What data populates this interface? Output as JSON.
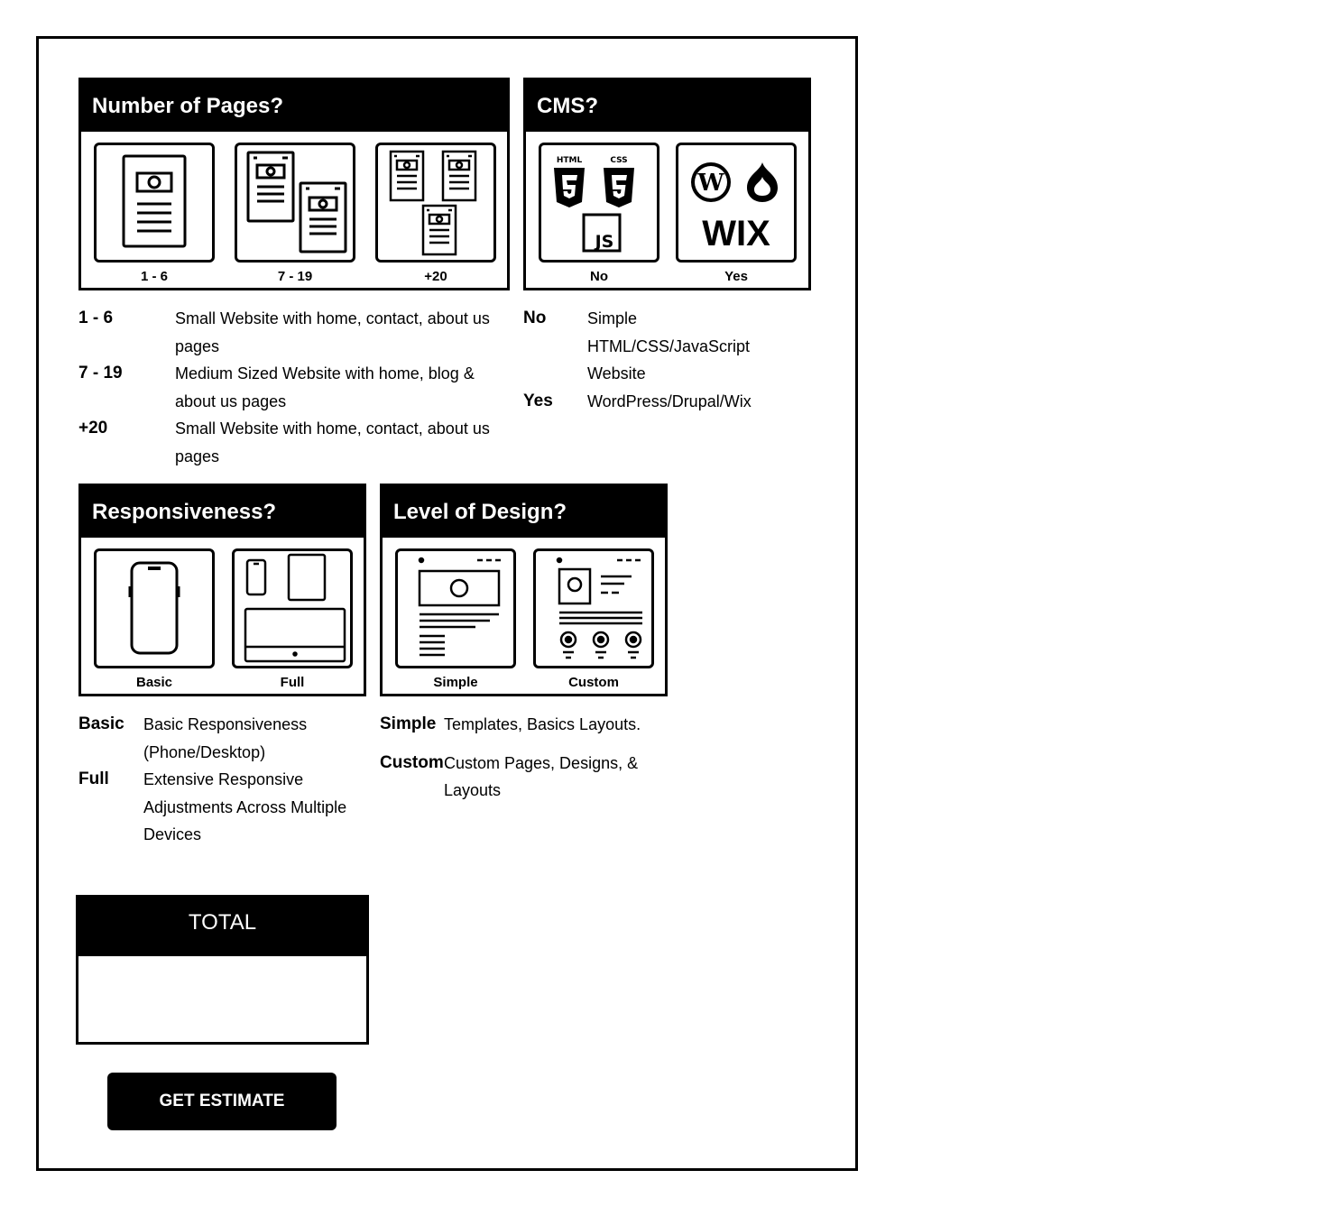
{
  "pages": {
    "title": "Number of Pages?",
    "options": [
      {
        "label": "1 - 6",
        "icon": "single-page-icon"
      },
      {
        "label": "7 - 19",
        "icon": "two-pages-icon"
      },
      {
        "label": "+20",
        "icon": "many-pages-icon"
      }
    ],
    "descriptions": [
      {
        "key": "1 - 6",
        "text": "Small Website with home, contact, about us pages"
      },
      {
        "key": "7 - 19",
        "text": "Medium Sized Website with home, blog & about us pages"
      },
      {
        "key": "+20",
        "text": "Small Website with home, contact, about us pages"
      }
    ]
  },
  "cms": {
    "title": "CMS?",
    "options": [
      {
        "label": "No",
        "icon": "html-css-js-icon",
        "html_text": "HTML",
        "css_text": "CSS",
        "js_text": "JS"
      },
      {
        "label": "Yes",
        "icon": "wordpress-drupal-wix-icon",
        "wix_text": "WIX"
      }
    ],
    "descriptions": [
      {
        "key": "No",
        "text": "Simple HTML/CSS/JavaScript Website"
      },
      {
        "key": "Yes",
        "text": "WordPress/Drupal/Wix"
      }
    ]
  },
  "responsiveness": {
    "title": "Responsiveness?",
    "options": [
      {
        "label": "Basic",
        "icon": "phone-icon"
      },
      {
        "label": "Full",
        "icon": "multi-device-icon"
      }
    ],
    "descriptions": [
      {
        "key": "Basic",
        "text": "Basic Responsiveness (Phone/Desktop)"
      },
      {
        "key": "Full",
        "text": "Extensive Responsive Adjustments Across Multiple Devices"
      }
    ]
  },
  "design": {
    "title": "Level of Design?",
    "options": [
      {
        "label": "Simple",
        "icon": "simple-layout-icon"
      },
      {
        "label": "Custom",
        "icon": "custom-layout-icon"
      }
    ],
    "descriptions": [
      {
        "key": "Simple",
        "text": "Templates, Basics Layouts."
      },
      {
        "key": "Custom",
        "text": "Custom Pages, Designs, & Layouts"
      }
    ]
  },
  "total": {
    "title": "TOTAL",
    "value": ""
  },
  "estimate_button": "GET ESTIMATE"
}
